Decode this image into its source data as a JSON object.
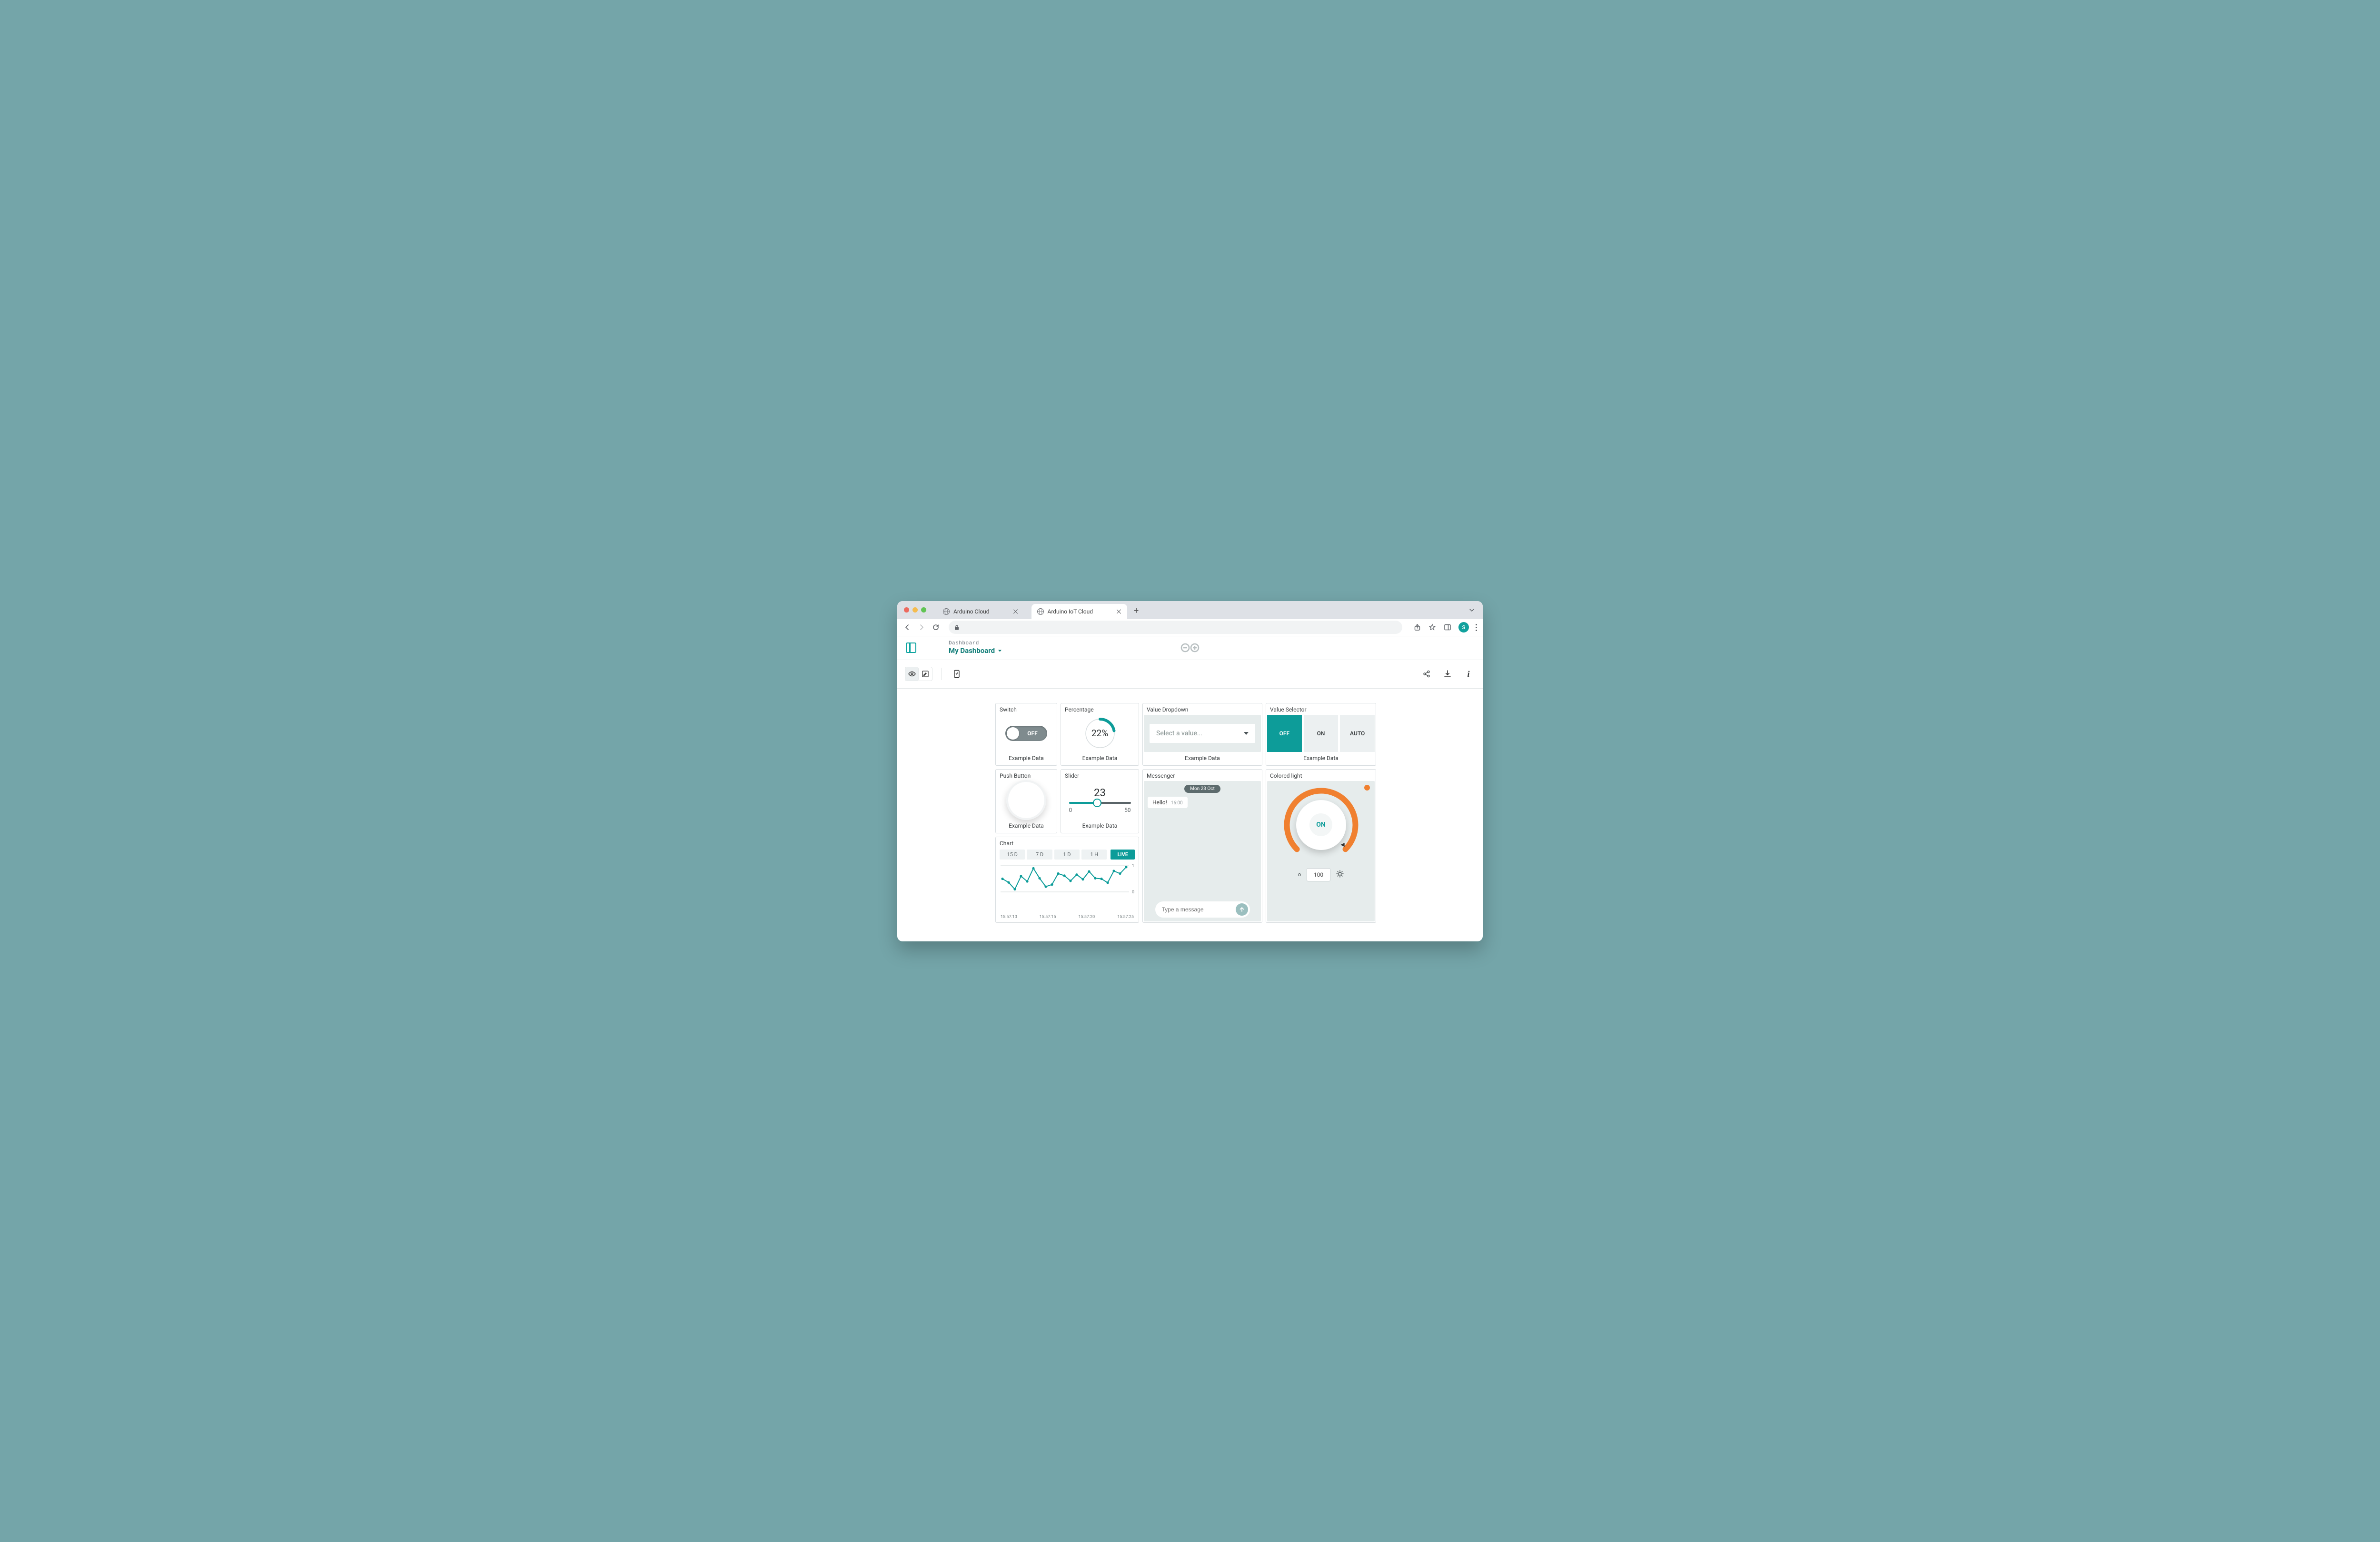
{
  "browser": {
    "tabs": [
      {
        "title": "Arduino Cloud",
        "active": false
      },
      {
        "title": "Arduino IoT Cloud",
        "active": true
      }
    ],
    "avatar": "S"
  },
  "header": {
    "breadcrumb": "Dashboard",
    "title": "My Dashboard"
  },
  "widgets": {
    "switch": {
      "title": "Switch",
      "state": "OFF",
      "footer": "Example Data"
    },
    "percent": {
      "title": "Percentage",
      "value": "22%",
      "fraction": 0.22,
      "footer": "Example Data"
    },
    "dropdown": {
      "title": "Value Dropdown",
      "placeholder": "Select a value...",
      "footer": "Example Data"
    },
    "selector": {
      "title": "Value Selector",
      "options": [
        "OFF",
        "ON",
        "AUTO"
      ],
      "selected": 0,
      "footer": "Example Data"
    },
    "push": {
      "title": "Push Button",
      "footer": "Example Data"
    },
    "slider": {
      "title": "Slider",
      "value": "23",
      "min": "0",
      "max": "50",
      "footer": "Example Data"
    },
    "chat": {
      "title": "Messenger",
      "date": "Mon 23 Oct",
      "msg_text": "Hello!",
      "msg_time": "16:00",
      "placeholder": "Type a message"
    },
    "light": {
      "title": "Colored light",
      "state": "ON",
      "brightness": "100"
    },
    "chart": {
      "title": "Chart",
      "ranges": [
        "15 D",
        "7 D",
        "1 D",
        "1 H"
      ],
      "live": "LIVE",
      "xticks": [
        "15:57:10",
        "15:57:15",
        "15:57:20",
        "15:57:25"
      ]
    }
  },
  "chart_data": {
    "type": "line",
    "title": "Chart",
    "xlabel": "",
    "ylabel": "",
    "ylim": [
      0,
      1
    ],
    "yticks": [
      0,
      1
    ],
    "xticks": [
      "15:57:10",
      "15:57:15",
      "15:57:20",
      "15:57:25"
    ],
    "series": [
      {
        "name": "Example Data",
        "x": [
          0,
          1,
          2,
          3,
          4,
          5,
          6,
          7,
          8,
          9,
          10,
          11,
          12,
          13,
          14,
          15,
          16,
          17,
          18,
          19,
          20
        ],
        "y": [
          0.5,
          0.36,
          0.1,
          0.6,
          0.4,
          0.9,
          0.52,
          0.2,
          0.28,
          0.7,
          0.62,
          0.42,
          0.66,
          0.48,
          0.78,
          0.52,
          0.5,
          0.35,
          0.8,
          0.7,
          0.95
        ]
      }
    ]
  }
}
